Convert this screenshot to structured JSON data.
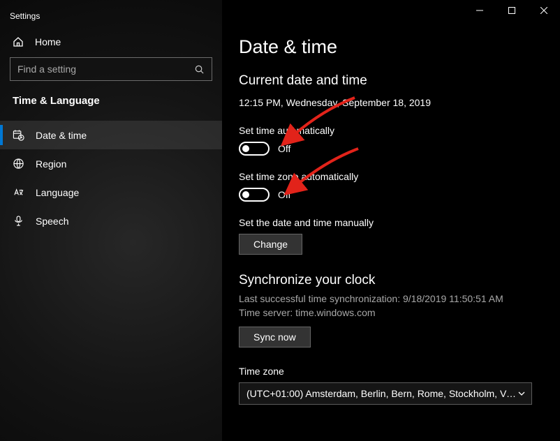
{
  "window": {
    "title": "Settings"
  },
  "sidebar": {
    "home": "Home",
    "search_placeholder": "Find a setting",
    "section": "Time & Language",
    "items": [
      {
        "label": "Date & time"
      },
      {
        "label": "Region"
      },
      {
        "label": "Language"
      },
      {
        "label": "Speech"
      }
    ]
  },
  "main": {
    "heading": "Date & time",
    "subheading": "Current date and time",
    "current_datetime": "12:15 PM, Wednesday, September 18, 2019",
    "set_time_auto": {
      "label": "Set time automatically",
      "state": "Off"
    },
    "set_tz_auto": {
      "label": "Set time zone automatically",
      "state": "Off"
    },
    "set_manual": {
      "label": "Set the date and time manually",
      "button": "Change"
    },
    "sync": {
      "heading": "Synchronize your clock",
      "last_sync": "Last successful time synchronization: 9/18/2019 11:50:51 AM",
      "server": "Time server: time.windows.com",
      "button": "Sync now"
    },
    "timezone": {
      "label": "Time zone",
      "value": "(UTC+01:00) Amsterdam, Berlin, Bern, Rome, Stockholm, Vie..."
    }
  }
}
